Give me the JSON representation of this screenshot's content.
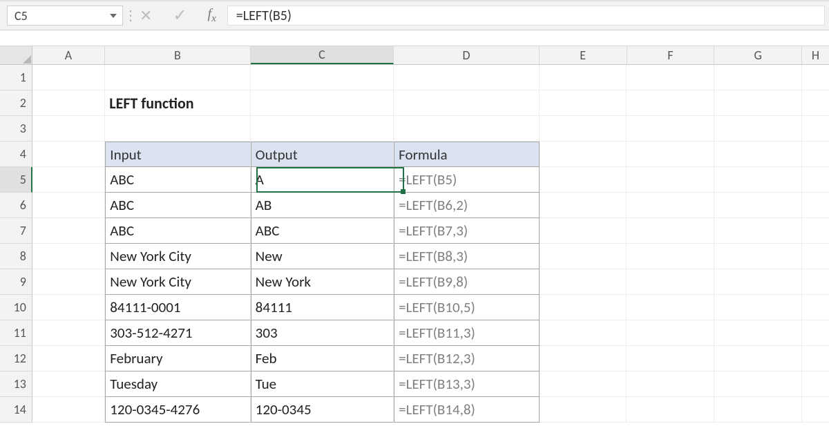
{
  "namebox": {
    "value": "C5"
  },
  "formula_bar": {
    "value": "=LEFT(B5)"
  },
  "columns": [
    "A",
    "B",
    "C",
    "D",
    "E",
    "F",
    "G",
    "H"
  ],
  "row_numbers": [
    "1",
    "2",
    "3",
    "4",
    "5",
    "6",
    "7",
    "8",
    "9",
    "10",
    "11",
    "12",
    "13",
    "14"
  ],
  "title": "LEFT function",
  "table": {
    "headers": {
      "input": "Input",
      "output": "Output",
      "formula": "Formula"
    },
    "rows": [
      {
        "input": "ABC",
        "output": "A",
        "formula": "=LEFT(B5)"
      },
      {
        "input": "ABC",
        "output": "AB",
        "formula": "=LEFT(B6,2)"
      },
      {
        "input": "ABC",
        "output": "ABC",
        "formula": "=LEFT(B7,3)"
      },
      {
        "input": "New York City",
        "output": "New",
        "formula": "=LEFT(B8,3)"
      },
      {
        "input": "New York City",
        "output": "New York",
        "formula": "=LEFT(B9,8)"
      },
      {
        "input": "84111-0001",
        "output": "84111",
        "formula": "=LEFT(B10,5)"
      },
      {
        "input": "303-512-4271",
        "output": "303",
        "formula": "=LEFT(B11,3)"
      },
      {
        "input": "February",
        "output": "Feb",
        "formula": "=LEFT(B12,3)"
      },
      {
        "input": "Tuesday",
        "output": "Tue",
        "formula": "=LEFT(B13,3)"
      },
      {
        "input": "120-0345-4276",
        "output": "120-0345",
        "formula": "=LEFT(B14,8)"
      }
    ]
  },
  "active_cell": "C5",
  "active_column_index": 2,
  "active_row_number": 5
}
